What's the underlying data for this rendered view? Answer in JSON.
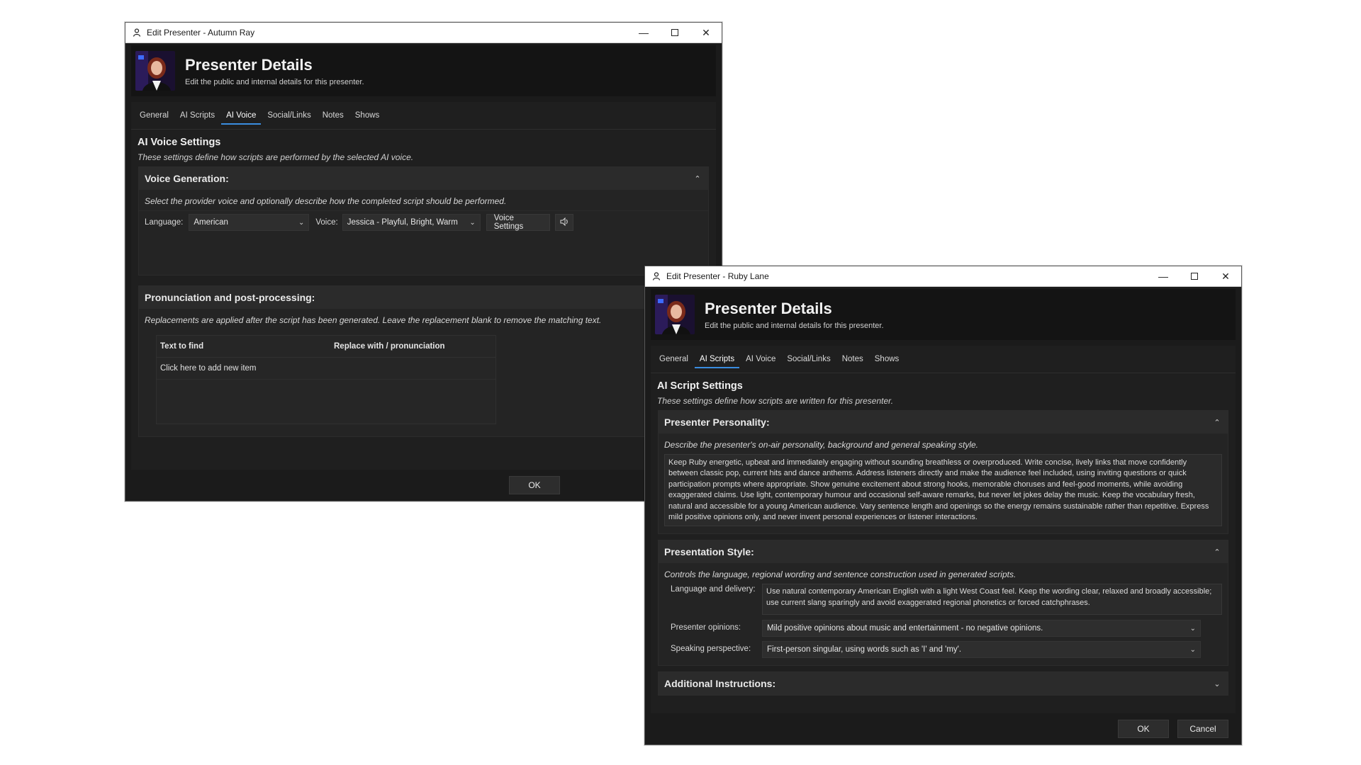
{
  "common": {
    "header_title": "Presenter Details",
    "header_subtitle": "Edit the public and internal details for this presenter.",
    "tabs": [
      "General",
      "AI Scripts",
      "AI Voice",
      "Social/Links",
      "Notes",
      "Shows"
    ],
    "ok_label": "OK",
    "cancel_label": "Cancel"
  },
  "win_a": {
    "title": "Edit Presenter - Autumn Ray",
    "active_tab": "AI Voice",
    "section_title": "AI Voice Settings",
    "section_sub": "These settings define how scripts are performed by the selected AI voice.",
    "voice_group": {
      "label": "Voice Generation:",
      "desc": "Select the provider voice and optionally describe how the completed script should be performed.",
      "language_label": "Language:",
      "language_value": "American",
      "voice_label": "Voice:",
      "voice_value": "Jessica - Playful, Bright, Warm",
      "voice_settings_label": "Voice Settings"
    },
    "pron_group": {
      "label": "Pronunciation and post-processing:",
      "desc": "Replacements are applied after the script has been generated. Leave the replacement blank to remove the matching text.",
      "col_find": "Text to find",
      "col_replace": "Replace with / pronunciation",
      "add_item": "Click here to add new item"
    }
  },
  "win_b": {
    "title": "Edit Presenter - Ruby Lane",
    "active_tab": "AI Scripts",
    "section_title": "AI Script Settings",
    "section_sub": "These settings define how scripts are written for this presenter.",
    "personality": {
      "label": "Presenter Personality:",
      "desc": "Describe the presenter's on-air personality, background and general speaking style.",
      "text": "Keep Ruby energetic, upbeat and immediately engaging without sounding breathless or overproduced. Write concise, lively links that move confidently between classic pop, current hits and dance anthems. Address listeners directly and make the audience feel included, using inviting questions or quick participation prompts where appropriate. Show genuine excitement about strong hooks, memorable choruses and feel-good moments, while avoiding exaggerated claims. Use light, contemporary humour and occasional self-aware remarks, but never let jokes delay the music. Keep the vocabulary fresh, natural and accessible for a young American audience. Vary sentence length and openings so the energy remains sustainable rather than repetitive. Express mild positive opinions only, and never invent personal experiences or listener interactions."
    },
    "style": {
      "label": "Presentation Style:",
      "desc": "Controls the language, regional wording and sentence construction used in generated scripts.",
      "lang_label": "Language and delivery:",
      "lang_text": "Use natural contemporary American English with a light West Coast feel. Keep the wording clear, relaxed and broadly accessible; use current slang sparingly and avoid exaggerated regional phonetics or forced catchphrases.",
      "opinions_label": "Presenter opinions:",
      "opinions_value": "Mild positive opinions about music and entertainment - no negative opinions.",
      "perspective_label": "Speaking perspective:",
      "perspective_value": "First-person singular, using words such as 'I' and 'my'."
    },
    "additional": {
      "label": "Additional Instructions:"
    }
  },
  "colors": {
    "accent": "#3a8de0",
    "window_bg": "#1b1b1b",
    "panel_bg": "#1f1f1f"
  }
}
